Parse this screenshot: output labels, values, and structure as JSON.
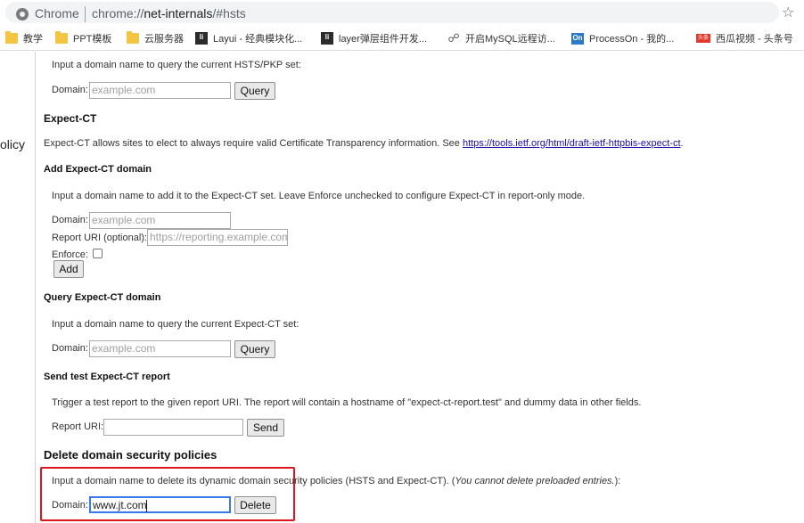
{
  "browser": {
    "scheme_label": "Chrome",
    "url_prefix": "chrome://",
    "url_host": "net-internals",
    "url_path": "/#hsts",
    "bookmarks": [
      {
        "label": "教学",
        "icon": "folder-icon"
      },
      {
        "label": "PPT模板",
        "icon": "folder-icon"
      },
      {
        "label": "云服务器",
        "icon": "folder-icon"
      },
      {
        "label": "Layui - 经典模块化...",
        "icon": "layui-favicon",
        "icon_text": "li"
      },
      {
        "label": "layer弹层组件开发...",
        "icon": "layui-favicon",
        "icon_text": "li"
      },
      {
        "label": "开启MySQL远程访...",
        "icon": "link-icon",
        "icon_text": "☍"
      },
      {
        "label": "ProcessOn - 我的...",
        "icon": "processon-favicon",
        "icon_text": "On"
      },
      {
        "label": "西瓜视频 - 头条号",
        "icon": "toutiao-favicon",
        "icon_text": "头条"
      }
    ]
  },
  "sidebar": {
    "partial_label": "olicy"
  },
  "hsts_query": {
    "prompt": "Input a domain name to query the current HSTS/PKP set:",
    "domain_label": "Domain:",
    "domain_placeholder": "example.com",
    "button": "Query"
  },
  "expect_ct": {
    "title": "Expect-CT",
    "description": "Expect-CT allows sites to elect to always require valid Certificate Transparency information. See ",
    "link": "https://tools.ietf.org/html/draft-ietf-httpbis-expect-ct",
    "link_suffix": "."
  },
  "add_expect_ct": {
    "title": "Add Expect-CT domain",
    "prompt": "Input a domain name to add it to the Expect-CT set. Leave Enforce unchecked to configure Expect-CT in report-only mode.",
    "domain_label": "Domain:",
    "domain_placeholder": "example.com",
    "report_uri_label": "Report URI (optional):",
    "report_uri_placeholder": "https://reporting.example.com",
    "enforce_label": "Enforce:",
    "button": "Add"
  },
  "query_expect_ct": {
    "title": "Query Expect-CT domain",
    "prompt": "Input a domain name to query the current Expect-CT set:",
    "domain_label": "Domain:",
    "domain_placeholder": "example.com",
    "button": "Query"
  },
  "send_test_report": {
    "title": "Send test Expect-CT report",
    "prompt": "Trigger a test report to the given report URI. The report will contain a hostname of \"expect-ct-report.test\" and dummy data in other fields.",
    "report_uri_label": "Report URI:",
    "report_uri_value": "",
    "button": "Send"
  },
  "delete_policies": {
    "title": "Delete domain security policies",
    "prompt": "Input a domain name to delete its dynamic domain security policies (HSTS and Expect-CT). (",
    "prompt_italic": "You cannot delete preloaded entries.",
    "prompt_end": "):",
    "domain_label": "Domain:",
    "domain_value": "www.jt.com",
    "button": "Delete",
    "highlight_color": "#e0141e"
  }
}
